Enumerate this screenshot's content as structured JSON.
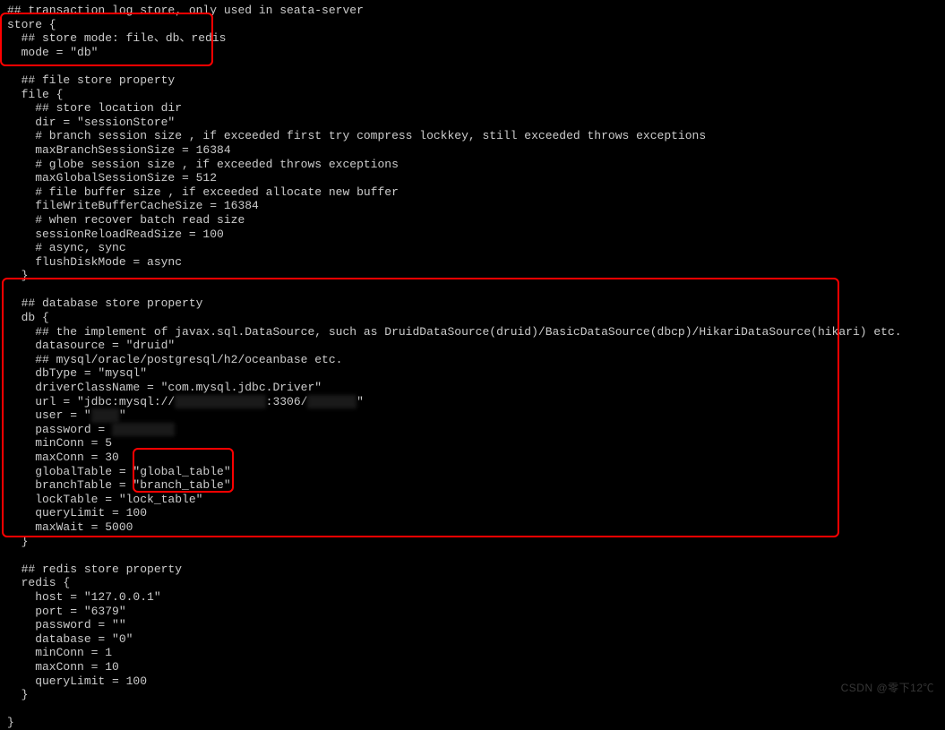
{
  "code": {
    "line01": "## transaction log store, only used in seata-server",
    "line02": "store {",
    "line03": "  ## store mode: file、db、redis",
    "line04": "  mode = \"db\"",
    "line05": "",
    "line06": "  ## file store property",
    "line07": "  file {",
    "line08": "    ## store location dir",
    "line09": "    dir = \"sessionStore\"",
    "line10": "    # branch session size , if exceeded first try compress lockkey, still exceeded throws exceptions",
    "line11": "    maxBranchSessionSize = 16384",
    "line12": "    # globe session size , if exceeded throws exceptions",
    "line13": "    maxGlobalSessionSize = 512",
    "line14": "    # file buffer size , if exceeded allocate new buffer",
    "line15": "    fileWriteBufferCacheSize = 16384",
    "line16": "    # when recover batch read size",
    "line17": "    sessionReloadReadSize = 100",
    "line18": "    # async, sync",
    "line19": "    flushDiskMode = async",
    "line20": "  }",
    "line21": "",
    "line22": "  ## database store property",
    "line23": "  db {",
    "line24": "    ## the implement of javax.sql.DataSource, such as DruidDataSource(druid)/BasicDataSource(dbcp)/HikariDataSource(hikari) etc.",
    "line25": "    datasource = \"druid\"",
    "line26": "    ## mysql/oracle/postgresql/h2/oceanbase etc.",
    "line27": "    dbType = \"mysql\"",
    "line28": "    driverClassName = \"com.mysql.jdbc.Driver\"",
    "line29a": "    url = \"jdbc:mysql://",
    "line29b": ":3306/",
    "line29c": "\"",
    "line30a": "    user = \"",
    "line30b": "\"",
    "line31a": "    password = ",
    "line31b": "",
    "line32": "    minConn = 5",
    "line33": "    maxConn = 30",
    "line34": "    globalTable = \"global_table\"",
    "line35": "    branchTable = \"branch_table\"",
    "line36": "    lockTable = \"lock_table\"",
    "line37": "    queryLimit = 100",
    "line38": "    maxWait = 5000",
    "line39": "  }",
    "line40": "",
    "line41": "  ## redis store property",
    "line42": "  redis {",
    "line43": "    host = \"127.0.0.1\"",
    "line44": "    port = \"6379\"",
    "line45": "    password = \"\"",
    "line46": "    database = \"0\"",
    "line47": "    minConn = 1",
    "line48": "    maxConn = 10",
    "line49": "    queryLimit = 100",
    "line50": "  }",
    "line51": "",
    "line52": "}"
  },
  "redacted": {
    "host": "xxxxxxxxxxxxx",
    "dbname": "xxxxxxx",
    "user": "xxxx",
    "password": "xxxxxxxxx"
  },
  "watermark": "CSDN @零下12℃"
}
